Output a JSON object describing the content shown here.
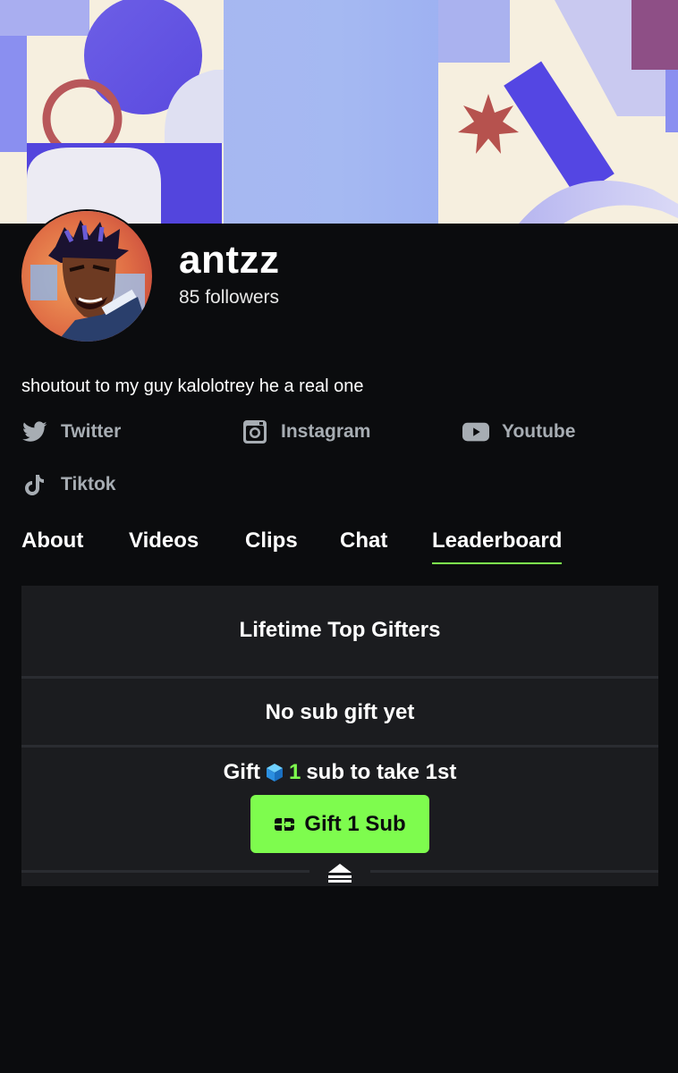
{
  "channel": {
    "name": "antzz",
    "followers": "85 followers",
    "bio": "shoutout to my guy kalolotrey he a real one"
  },
  "socials": [
    {
      "label": "Twitter",
      "icon": "twitter-icon"
    },
    {
      "label": "Instagram",
      "icon": "instagram-icon"
    },
    {
      "label": "Youtube",
      "icon": "youtube-icon"
    },
    {
      "label": "Tiktok",
      "icon": "tiktok-icon"
    }
  ],
  "tabs": [
    {
      "label": "About",
      "active": false
    },
    {
      "label": "Videos",
      "active": false
    },
    {
      "label": "Clips",
      "active": false
    },
    {
      "label": "Chat",
      "active": false
    },
    {
      "label": "Leaderboard",
      "active": true
    }
  ],
  "leaderboard": {
    "title": "Lifetime Top Gifters",
    "empty_text": "No sub gift yet",
    "cta_prefix": "Gift",
    "cta_count": "1",
    "cta_suffix": "sub to take 1st",
    "button_label": "Gift 1 Sub"
  },
  "colors": {
    "background": "#0b0c0e",
    "card": "#1b1c1f",
    "accent": "#7efc4e",
    "muted_text": "#a7adb3"
  }
}
